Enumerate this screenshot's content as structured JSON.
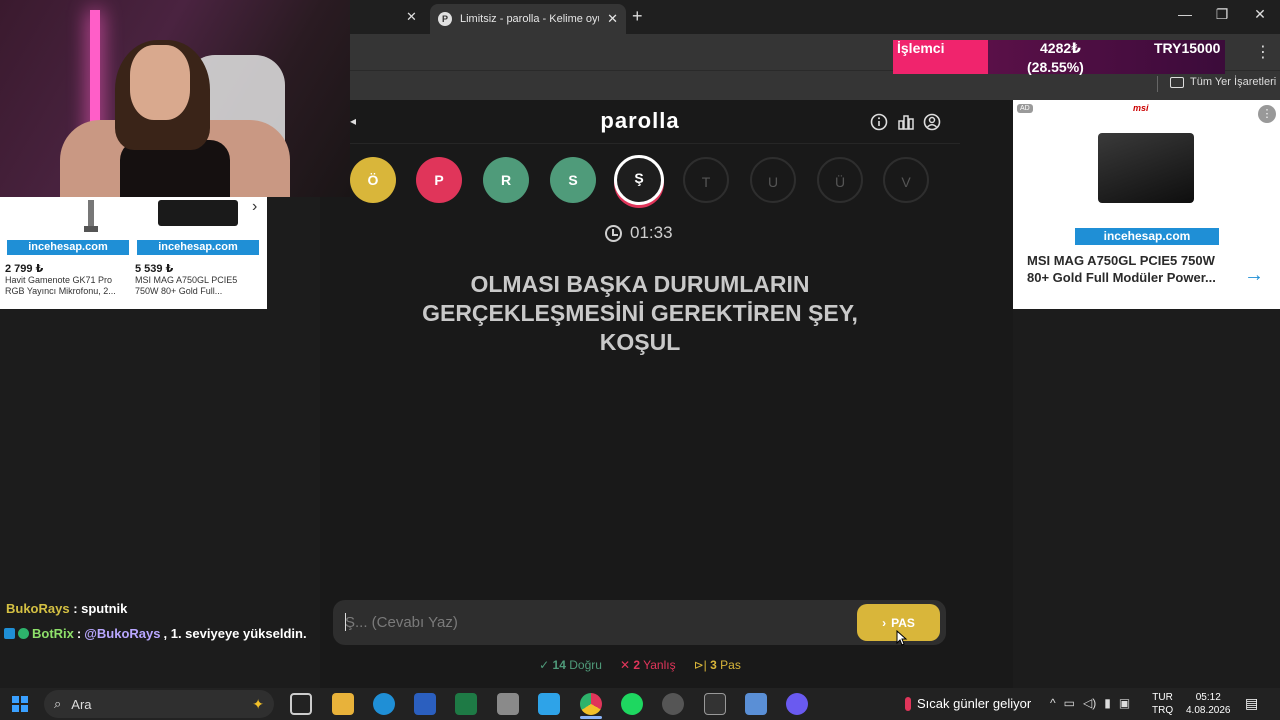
{
  "browser": {
    "active_tab_title": "Limitsiz - parolla - Kelime oyunu",
    "tab_close": "✕",
    "new_tab": "+",
    "bookmarks_folder": "Tüm Yer İşaretleri",
    "window_buttons": [
      "—",
      "❐",
      "✕"
    ]
  },
  "overlay": {
    "label": "İşlemci",
    "value": "4282₺",
    "percent": "(28.55%)",
    "target": "TRY15000"
  },
  "game": {
    "logo": "parolla",
    "letters": [
      {
        "char": "Ö",
        "state": "pass",
        "color": "#d9b63a"
      },
      {
        "char": "P",
        "state": "wrong",
        "color": "#e0355a"
      },
      {
        "char": "R",
        "state": "correct",
        "color": "#4f9b7a"
      },
      {
        "char": "S",
        "state": "correct",
        "color": "#4f9b7a"
      },
      {
        "char": "Ş",
        "state": "active",
        "color": "#1e1e1e"
      },
      {
        "char": "T",
        "state": "empty"
      },
      {
        "char": "U",
        "state": "empty"
      },
      {
        "char": "Ü",
        "state": "empty"
      },
      {
        "char": "V",
        "state": "empty"
      }
    ],
    "timer": "01:33",
    "question": "OLMASI BAŞKA DURUMLARIN GERÇEKLEŞMESİNİ GEREKTİREN ŞEY, KOŞUL",
    "answer_placeholder": "Ş... (Cevabı Yaz)",
    "pass_button": "PAS",
    "stats": {
      "correct_count": "14",
      "correct_label": "Doğru",
      "wrong_count": "2",
      "wrong_label": "Yanlış",
      "pass_count": "3",
      "pass_label": "Pas"
    }
  },
  "ad_right": {
    "badge": "AD",
    "brand": "msi",
    "store": "incehesap.com",
    "title": "MSI MAG A750GL PCIE5 750W 80+ Gold Full Modüler Power..."
  },
  "ad_left": {
    "products": [
      {
        "store": "incehesap.com",
        "price": "2 799 ₺",
        "name": "Havit Gamenote GK71 Pro RGB Yayıncı Mikrofonu, 2..."
      },
      {
        "store": "incehesap.com",
        "price": "5 539 ₺",
        "name": "MSI MAG A750GL PCIE5 750W 80+ Gold Full..."
      }
    ]
  },
  "chat": [
    {
      "user": "BukoRays",
      "sep": " : ",
      "message": "sputnik"
    },
    {
      "user": "BotRix",
      "sep": " : ",
      "mention": "@BukoRays",
      "message": ", 1. seviyeye yükseldin."
    }
  ],
  "taskbar": {
    "search": "Ara",
    "weather": "Sıcak günler geliyor",
    "lang_top": "TUR",
    "lang_bottom": "TRQ",
    "time": "05:12",
    "date": "4.08.2026"
  },
  "colors": {
    "correct": "#4f9b7a",
    "wrong": "#e0355a",
    "pass": "#d9b63a",
    "store_blue": "#1f8fd6"
  }
}
